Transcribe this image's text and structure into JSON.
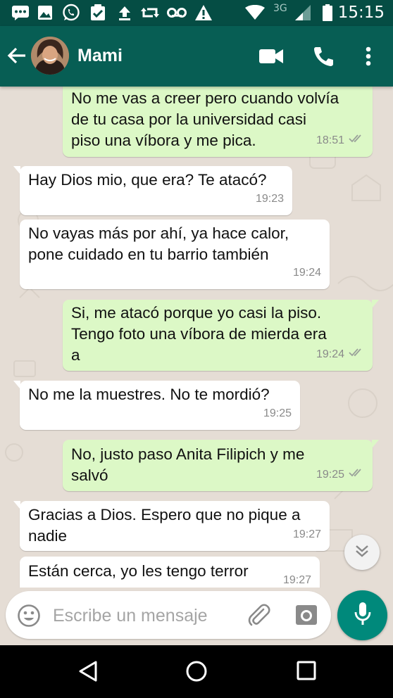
{
  "status_bar": {
    "time": "15:15",
    "network_label": "3G",
    "icons": [
      "message-icon",
      "image-icon",
      "whatsapp-icon",
      "task-check-icon",
      "upload-icon",
      "sync-icon",
      "voicemail-icon",
      "warning-icon",
      "wifi-icon",
      "signal-icon",
      "battery-icon"
    ]
  },
  "header": {
    "contact_name": "Mami",
    "icons": [
      "back-arrow-icon",
      "video-call-icon",
      "phone-icon",
      "more-vert-icon"
    ],
    "color": "#075e54"
  },
  "messages": [
    {
      "direction": "out",
      "lines": [
        "No me vas a creer pero cuando volvía",
        "de tu casa por la universidad casi",
        "piso una víbora y me pica."
      ],
      "time": "18:51",
      "read": true
    },
    {
      "direction": "in",
      "lines": [
        "Hay Dios mio, que era? Te atacó?"
      ],
      "time": "19:23"
    },
    {
      "direction": "in",
      "lines": [
        "No vayas más por ahí, ya hace calor,",
        "pone cuidado en tu barrio también"
      ],
      "time": "19:24"
    },
    {
      "direction": "out",
      "lines": [
        "Si, me atacó porque yo casi la piso.",
        "Tengo foto una víbora de mierda era",
        "a"
      ],
      "time": "19:24",
      "read": true
    },
    {
      "direction": "in",
      "lines": [
        "No me la muestres. No te mordió?"
      ],
      "time": "19:25"
    },
    {
      "direction": "out",
      "lines": [
        "No, justo paso Anita Filipich y me",
        "salvó"
      ],
      "time": "19:25",
      "read": true
    },
    {
      "direction": "in",
      "lines": [
        "Gracias a Dios. Espero que no pique a",
        "nadie"
      ],
      "time": "19:27"
    },
    {
      "direction": "in",
      "lines": [
        "Están cerca, yo les tengo terror"
      ],
      "time": "19:27"
    }
  ],
  "composer": {
    "placeholder": "Escribe un mensaje",
    "icons": [
      "emoji-icon",
      "attach-icon",
      "camera-icon",
      "mic-icon"
    ]
  },
  "colors": {
    "incoming_bubble": "#ffffff",
    "outgoing_bubble": "#dcf8c6",
    "chat_background": "#e5ddd5",
    "accent": "#00897b"
  },
  "nav_bar": {
    "icons": [
      "back-triangle-icon",
      "home-circle-icon",
      "recents-square-icon"
    ]
  }
}
